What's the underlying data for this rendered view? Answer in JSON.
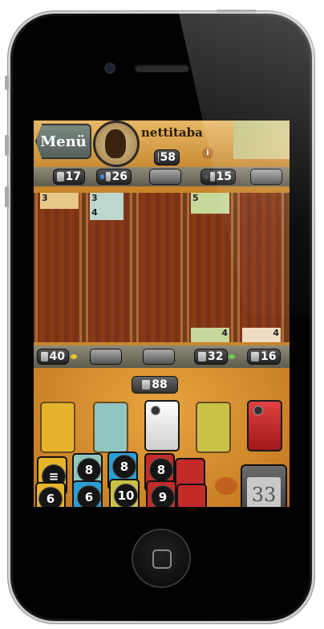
{
  "game": {
    "menu_label": "Menü",
    "player_name": "nettitaba",
    "top_score": "58",
    "top_lanes": [
      "17",
      "26",
      "",
      "15",
      ""
    ],
    "bottom_lanes": [
      "40",
      "",
      "",
      "32",
      "16"
    ],
    "pool_score": "88",
    "board_tiles": [
      {
        "label": "3",
        "lane": 0,
        "kind": "sand"
      },
      {
        "label": "3",
        "lane": 1,
        "kind": "blue"
      },
      {
        "label": "4",
        "lane": 1,
        "kind": "blue"
      },
      {
        "label": "5",
        "lane": 3,
        "kind": "green"
      },
      {
        "label": "4",
        "lane": 3,
        "kind": "green"
      },
      {
        "label": "4",
        "lane": 4,
        "kind": "red"
      }
    ],
    "hand_top": [
      "8",
      "8",
      "8"
    ],
    "hand_bottom": [
      "6",
      "6",
      "10",
      "9"
    ],
    "deck_count": "33"
  },
  "colors": {
    "yellow": "#e6b42a",
    "teal": "#8fc7c0",
    "white": "#f2f2f2",
    "olive": "#c9c247",
    "red": "#c42a2a"
  }
}
